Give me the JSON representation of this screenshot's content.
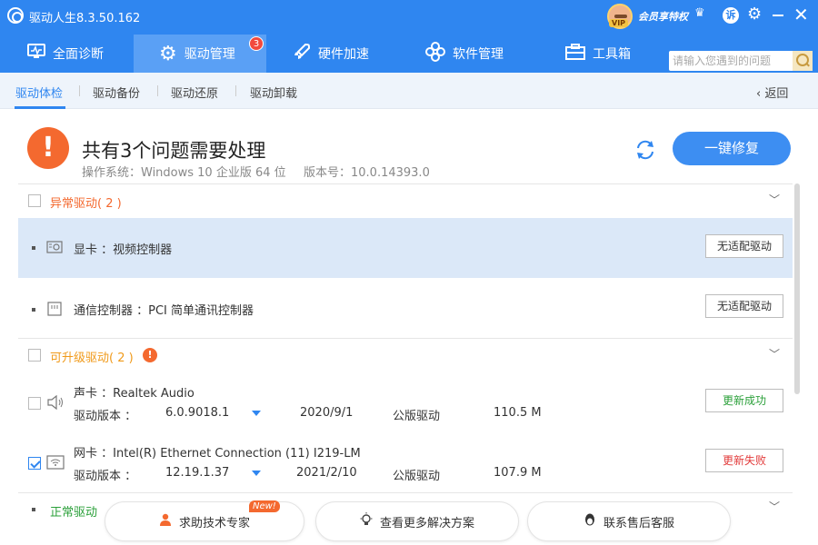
{
  "app": {
    "title": "驱动人生8.3.50.162"
  },
  "titlebar": {
    "vip_text": "会员享特权",
    "vip_tag": "VIP",
    "feedback_glyph": "诉"
  },
  "nav": {
    "tabs": [
      {
        "label": "全面诊断"
      },
      {
        "label": "驱动管理",
        "badge": "3"
      },
      {
        "label": "硬件加速"
      },
      {
        "label": "软件管理"
      },
      {
        "label": "工具箱"
      }
    ],
    "search_placeholder": "请输入您遇到的问题"
  },
  "subnav": {
    "tabs": [
      "驱动体检",
      "驱动备份",
      "驱动还原",
      "驱动卸载"
    ],
    "back": "返回"
  },
  "summary": {
    "title": "共有3个问题需要处理",
    "os": "操作系统：Windows 10 企业版 64 位",
    "version": "版本号：10.0.14393.0",
    "fix_button": "一键修复"
  },
  "groups": {
    "abnormal": {
      "label": "异常驱动( 2 )"
    },
    "upgradable": {
      "label": "可升级驱动( 2 )"
    },
    "normal": {
      "label": "正常驱动"
    }
  },
  "abnormal_items": [
    {
      "name": "显卡 ：视频控制器",
      "action": "无适配驱动"
    },
    {
      "name": "通信控制器 ：PCI 简单通讯控制器",
      "action": "无适配驱动"
    }
  ],
  "upgrade_items": [
    {
      "name": "声卡 ：Realtek Audio",
      "version_label": "驱动版本 ：",
      "version": "6.0.9018.1",
      "date": "2020/9/1",
      "type": "公版驱动",
      "size": "110.5 M",
      "status": "更新成功",
      "checked": false
    },
    {
      "name": "网卡 ：Intel(R) Ethernet Connection (11) I219-LM",
      "version_label": "驱动版本 ：",
      "version": "12.19.1.37",
      "date": "2021/2/10",
      "type": "公版驱动",
      "size": "107.9 M",
      "status": "更新失败",
      "checked": true
    }
  ],
  "bottom": {
    "expert": "求助技术专家",
    "new_badge": "New!",
    "solutions": "查看更多解决方案",
    "support": "联系售后客服"
  },
  "colors": {
    "brand": "#2f86f0",
    "warning": "#f4692f",
    "success": "#2ba03a",
    "fail": "#e23b3b"
  }
}
